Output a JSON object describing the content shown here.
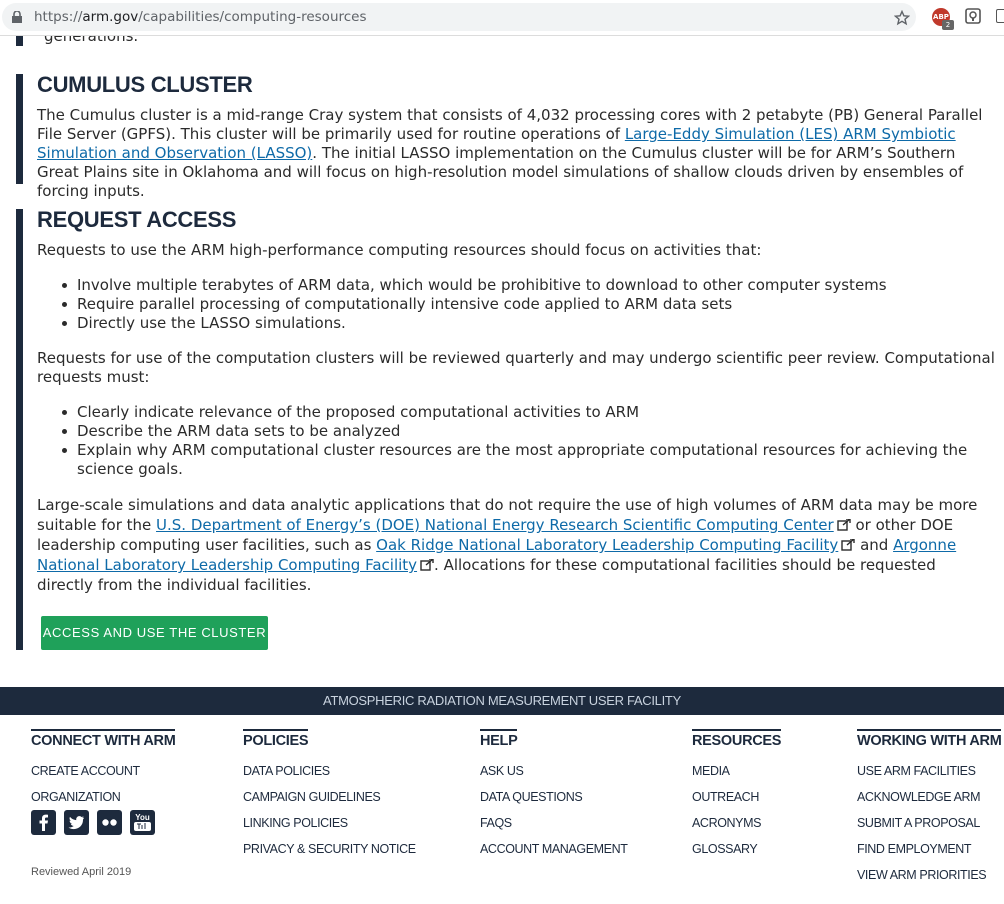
{
  "browser": {
    "url_prefix": "https://",
    "url_domain": "arm.gov",
    "url_path": "/capabilities/computing-resources",
    "ext_badge": "2",
    "ext_label": "ABP"
  },
  "top_section": {
    "trailing_text": "generations."
  },
  "cumulus": {
    "heading": "CUMULUS CLUSTER",
    "p1": "The Cumulus cluster is a mid-range Cray system that consists of 4,032 processing cores with 2 petabyte (PB) General Parallel File Server (GPFS). This cluster will be primarily used for routine operations of ",
    "link": "Large-Eddy Simulation (LES) ARM Symbiotic Simulation and Observation (LASSO)",
    "p2": ". The initial LASSO implementation on the Cumulus cluster will be for ARM’s Southern Great Plains site in Oklahoma and will focus on high-resolution model simulations of shallow clouds driven by ensembles of forcing inputs."
  },
  "request": {
    "heading": "REQUEST ACCESS",
    "intro": "Requests to use the ARM high-performance computing resources should focus on activities that:",
    "list1": [
      "Involve multiple terabytes of ARM data, which would be prohibitive to download to other computer systems",
      "Require parallel processing of computationally intensive code applied to ARM data sets",
      "Directly use the LASSO simulations."
    ],
    "review": "Requests for use of the computation clusters will be reviewed quarterly and may undergo scientific peer review. Computational requests must:",
    "list2": [
      "Clearly indicate relevance of the proposed computational activities to ARM",
      "Describe the ARM data sets to be analyzed",
      "Explain why ARM computational cluster resources are the most appropriate computational resources for achieving the science goals."
    ],
    "closing_a": "Large-scale simulations and data analytic applications that do not require the use of high volumes of ARM data may be more suitable for the ",
    "link_nersc": "U.S. Department of Energy’s (DOE) National Energy Research Scientific Computing Center",
    "closing_b": " or other DOE leadership computing user facilities, such as ",
    "link_ornl": "Oak Ridge National Laboratory Leadership Computing Facility",
    "closing_c": " and ",
    "link_anl": "Argonne National Laboratory Leadership Computing Facility",
    "closing_d": ". Allocations for these computational facilities should be requested directly from the individual facilities.",
    "cta": "ACCESS AND USE THE CLUSTER"
  },
  "footer": {
    "band": "ATMOSPHERIC RADIATION MEASUREMENT USER FACILITY",
    "cols": [
      {
        "head": "CONNECT WITH ARM",
        "links": [
          "CREATE ACCOUNT",
          "ORGANIZATION"
        ]
      },
      {
        "head": "POLICIES",
        "links": [
          "DATA POLICIES",
          "CAMPAIGN GUIDELINES",
          "LINKING POLICIES",
          "PRIVACY & SECURITY NOTICE"
        ]
      },
      {
        "head": "HELP",
        "links": [
          "ASK US",
          "DATA QUESTIONS",
          "FAQS",
          "ACCOUNT MANAGEMENT"
        ]
      },
      {
        "head": "RESOURCES",
        "links": [
          "MEDIA",
          "OUTREACH",
          "ACRONYMS",
          "GLOSSARY"
        ]
      },
      {
        "head": "WORKING WITH ARM",
        "links": [
          "USE ARM FACILITIES",
          "ACKNOWLEDGE ARM",
          "SUBMIT A PROPOSAL",
          "FIND EMPLOYMENT",
          "VIEW ARM PRIORITIES"
        ]
      }
    ],
    "social": [
      "facebook-icon",
      "twitter-icon",
      "flickr-icon",
      "youtube-icon"
    ],
    "youtube_text": "You",
    "reviewed": "Reviewed April 2019"
  }
}
